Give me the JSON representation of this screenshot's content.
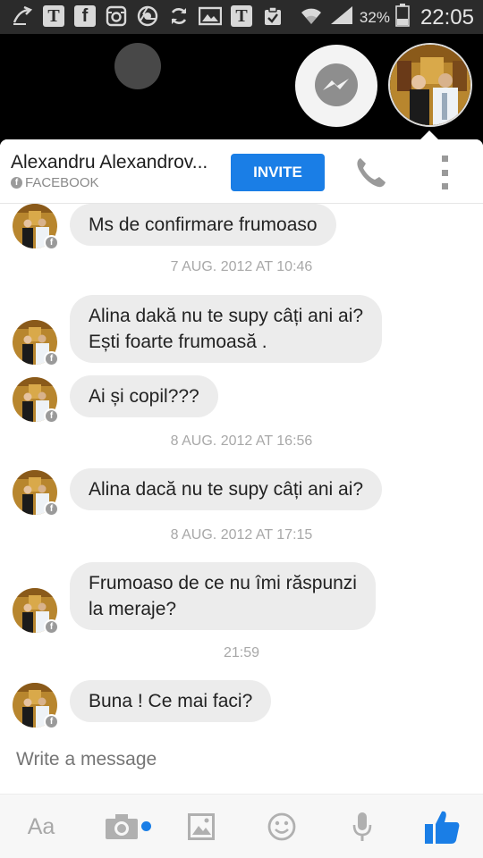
{
  "status_bar": {
    "battery_percent": "32%",
    "time": "22:05",
    "icons": [
      "back-swoop-icon",
      "t-box-icon",
      "facebook-icon",
      "instagram-icon",
      "chrome-icon",
      "sync-icon",
      "gallery-icon",
      "t-box-icon",
      "clipboard-check-icon",
      "wifi-icon",
      "signal-icon",
      "battery-icon"
    ]
  },
  "header": {
    "contact_name": "Alexandru Alexandrov...",
    "source": "FACEBOOK",
    "invite_label": "INVITE"
  },
  "messages": [
    {
      "type": "bubble",
      "text": [
        "Ms de confirmare frumoaso"
      ]
    },
    {
      "type": "timestamp",
      "text": "7 AUG. 2012 AT 10:46"
    },
    {
      "type": "bubble",
      "text": [
        "Alina dakă nu te supy câți ani ai?",
        "Ești foarte frumoasă ."
      ]
    },
    {
      "type": "bubble",
      "text": [
        "Ai și copil???"
      ]
    },
    {
      "type": "timestamp",
      "text": "8 AUG. 2012 AT 16:56"
    },
    {
      "type": "bubble",
      "text": [
        "Alina dacă nu te supy câți ani ai?"
      ]
    },
    {
      "type": "timestamp",
      "text": "8 AUG. 2012 AT 17:15"
    },
    {
      "type": "bubble",
      "text": [
        "Frumoaso de ce nu îmi răspunzi",
        "la meraje?"
      ]
    },
    {
      "type": "timestamp",
      "text": "21:59"
    },
    {
      "type": "bubble",
      "text": [
        "Buna ! Ce mai faci?"
      ]
    }
  ],
  "compose": {
    "placeholder": "Write a message"
  },
  "toolbar": {
    "text_label": "Aa"
  },
  "colors": {
    "accent": "#1a7ee6",
    "bubble_bg": "#ececec",
    "timestamp": "#a8a8a8"
  }
}
